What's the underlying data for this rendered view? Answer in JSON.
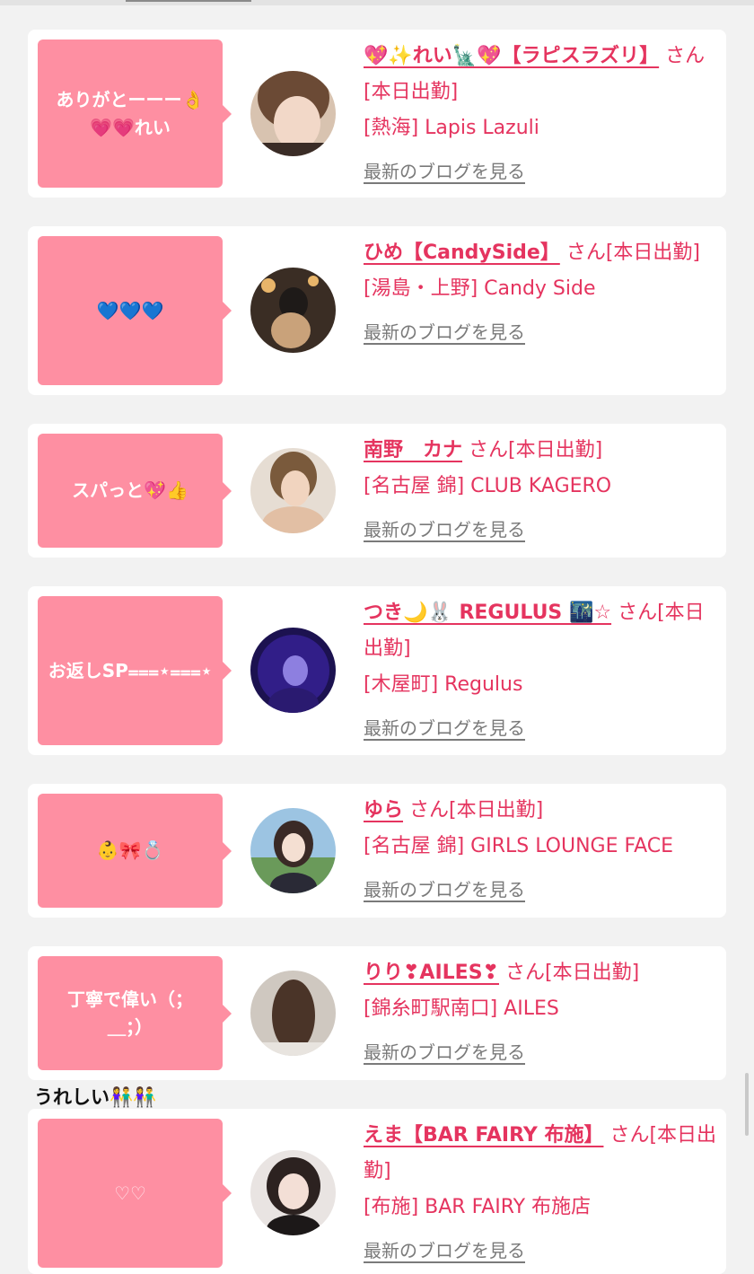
{
  "cards": [
    {
      "message_lines": [
        "ありがとーーー👌",
        "💗💗れい"
      ],
      "name": "💖✨れい🗽💖【ラピスラズリ】",
      "suffix": "さん[本日出勤]",
      "shop": "[熱海] Lapis Lazuli",
      "blog_link": "最新のブログを見る"
    },
    {
      "message_lines": [
        "💙💙💙"
      ],
      "name": "ひめ【CandySide】",
      "suffix": "さん[本日出勤]",
      "shop": "[湯島・上野] Candy Side",
      "blog_link": "最新のブログを見る"
    },
    {
      "message_lines": [
        "スパっと💖👍"
      ],
      "name": "南野　カナ",
      "suffix": "さん[本日出勤]",
      "shop": "[名古屋 錦] CLUB KAGERO",
      "blog_link": "最新のブログを見る"
    },
    {
      "message_lines": [
        "お返しSP⩶⋆⩶⋆"
      ],
      "name": "つき🌙🐰 REGULUS 🌃☆",
      "suffix": "さん[本日出勤]",
      "shop": "[木屋町] Regulus",
      "blog_link": "最新のブログを見る"
    },
    {
      "message_lines": [
        "👶🎀💍"
      ],
      "name": "ゆら",
      "suffix": "さん[本日出勤]",
      "shop": "[名古屋 錦] GIRLS LOUNGE FACE",
      "blog_link": "最新のブログを見る"
    },
    {
      "message_lines": [
        "丁寧で偉い（；",
        "＿；）"
      ],
      "name": "りり❣AILES❣",
      "suffix": "さん[本日出勤]",
      "shop": "[錦糸町駅南口] AILES",
      "blog_link": "最新のブログを見る"
    },
    {
      "message_lines": [
        "♡♡"
      ],
      "name": "えま【BAR FAIRY 布施】",
      "suffix": "さん[本日出勤]",
      "shop": "[布施] BAR FAIRY 布施店",
      "blog_link": "最新のブログを見る"
    }
  ],
  "interlude_text": "うれしい👫👫",
  "colors": {
    "accent": "#e5345f",
    "bubble": "#fe8fa2",
    "background": "#f2f2f2"
  }
}
